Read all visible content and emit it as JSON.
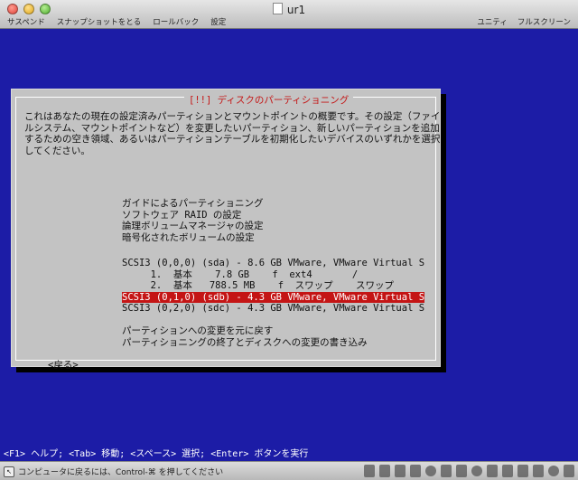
{
  "window": {
    "title": "ur1",
    "toolbar_left": [
      "サスペンド",
      "スナップショットをとる",
      "ロールバック",
      "設定"
    ],
    "toolbar_right": [
      "ユニティ",
      "フルスクリーン"
    ]
  },
  "dialog": {
    "title": "[!!] ディスクのパーティショニング",
    "description": [
      "これはあなたの現在の設定済みパーティションとマウントポイントの概要です。その設定（ファイ",
      "ルシステム、マウントポイントなど）を変更したいパーティション、新しいパーティションを追加",
      "するための空き領域、あるいはパーティションテーブルを初期化したいデバイスのいずれかを選択",
      "してください。"
    ],
    "menu_options": [
      "ガイドによるパーティショニング",
      "ソフトウェア RAID の設定",
      "論理ボリュームマネージャの設定",
      "暗号化されたボリュームの設定"
    ],
    "disks": [
      "SCSI3 (0,0,0) (sda) - 8.6 GB VMware, VMware Virtual S",
      "     1.  基本    7.8 GB    f  ext4       /",
      "     2.  基本   788.5 MB    f  スワップ    スワップ",
      "SCSI3 (0,1,0) (sdb) - 4.3 GB VMware, VMware Virtual S",
      "SCSI3 (0,2,0) (sdc) - 4.3 GB VMware, VMware Virtual S"
    ],
    "actions": [
      "パーティションへの変更を元に戻す",
      "パーティショニングの終了とディスクへの変更の書き込み"
    ],
    "back": "<戻る>"
  },
  "status_line": "<F1> ヘルプ; <Tab> 移動; <スペース> 選択; <Enter> ボタンを実行",
  "bottom_hint": "コンピュータに戻るには、Control-⌘ を押してください",
  "colors": {
    "background": "#1c1ca6",
    "dialog": "#c3c3c3",
    "accent": "#c41515"
  }
}
